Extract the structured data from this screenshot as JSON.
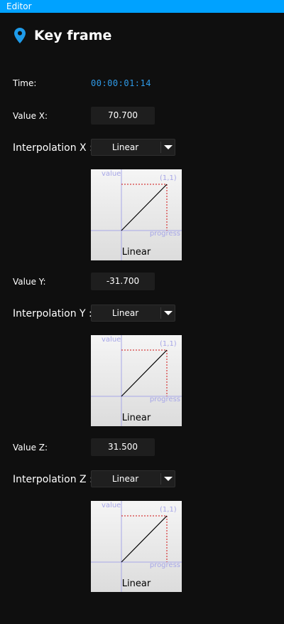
{
  "window": {
    "title": "Editor"
  },
  "header": {
    "title": "Key frame",
    "icon": "location-pin-icon",
    "icon_color": "#1e9be9"
  },
  "time": {
    "label": "Time:",
    "value": "00:00:01:14",
    "color": "#2f9be9"
  },
  "axes": [
    {
      "value_label": "Value X:",
      "value": "70.700",
      "interp_label": "Interpolation X :",
      "interp_value": "Linear",
      "curve": {
        "axis_value": "value",
        "axis_progress": "progress",
        "end_point": "(1,1)",
        "name": "Linear"
      }
    },
    {
      "value_label": "Value Y:",
      "value": "-31.700",
      "interp_label": "Interpolation Y :",
      "interp_value": "Linear",
      "curve": {
        "axis_value": "value",
        "axis_progress": "progress",
        "end_point": "(1,1)",
        "name": "Linear"
      }
    },
    {
      "value_label": "Value Z:",
      "value": "31.500",
      "interp_label": "Interpolation Z :",
      "interp_value": "Linear",
      "curve": {
        "axis_value": "value",
        "axis_progress": "progress",
        "end_point": "(1,1)",
        "name": "Linear"
      }
    }
  ],
  "colors": {
    "accent": "#00a2ff",
    "background": "#0f0f0f",
    "field": "#1e1e1e",
    "curve_guides": "#a7a7e8",
    "curve_bound": "#d01010"
  }
}
